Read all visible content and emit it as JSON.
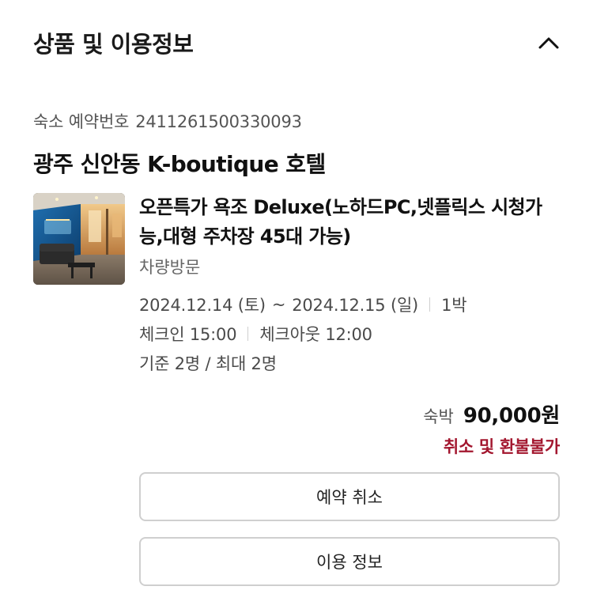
{
  "section": {
    "title": "상품 및 이용정보",
    "toggle_icon": "chevron-up-icon"
  },
  "reservation": {
    "label": "숙소 예약번호",
    "number": "2411261500330093"
  },
  "hotel": {
    "name": "광주 신안동 K-boutique 호텔"
  },
  "room": {
    "thumbnail_icon": "room-photo",
    "name": "오픈특가 욕조 Deluxe(노하드PC,넷플릭스 시청가능,대형 주차장 45대 가능)",
    "visit_type": "차량방문"
  },
  "stay": {
    "checkin_date": "2024.12.14 (토)",
    "tilde": "~",
    "checkout_date": "2024.12.15 (일)",
    "nights": "1박",
    "checkin_time": "체크인 15:00",
    "checkout_time": "체크아웃 12:00",
    "occupancy": "기준 2명 / 최대 2명"
  },
  "price": {
    "label": "숙박",
    "value": "90,000원"
  },
  "refund": {
    "note": "취소 및 환불불가"
  },
  "buttons": {
    "cancel_label": "예약 취소",
    "info_label": "이용 정보"
  },
  "colors": {
    "accent_red": "#a3172f",
    "border": "#cfcfcf",
    "text_primary": "#111111",
    "text_secondary": "#555555"
  }
}
